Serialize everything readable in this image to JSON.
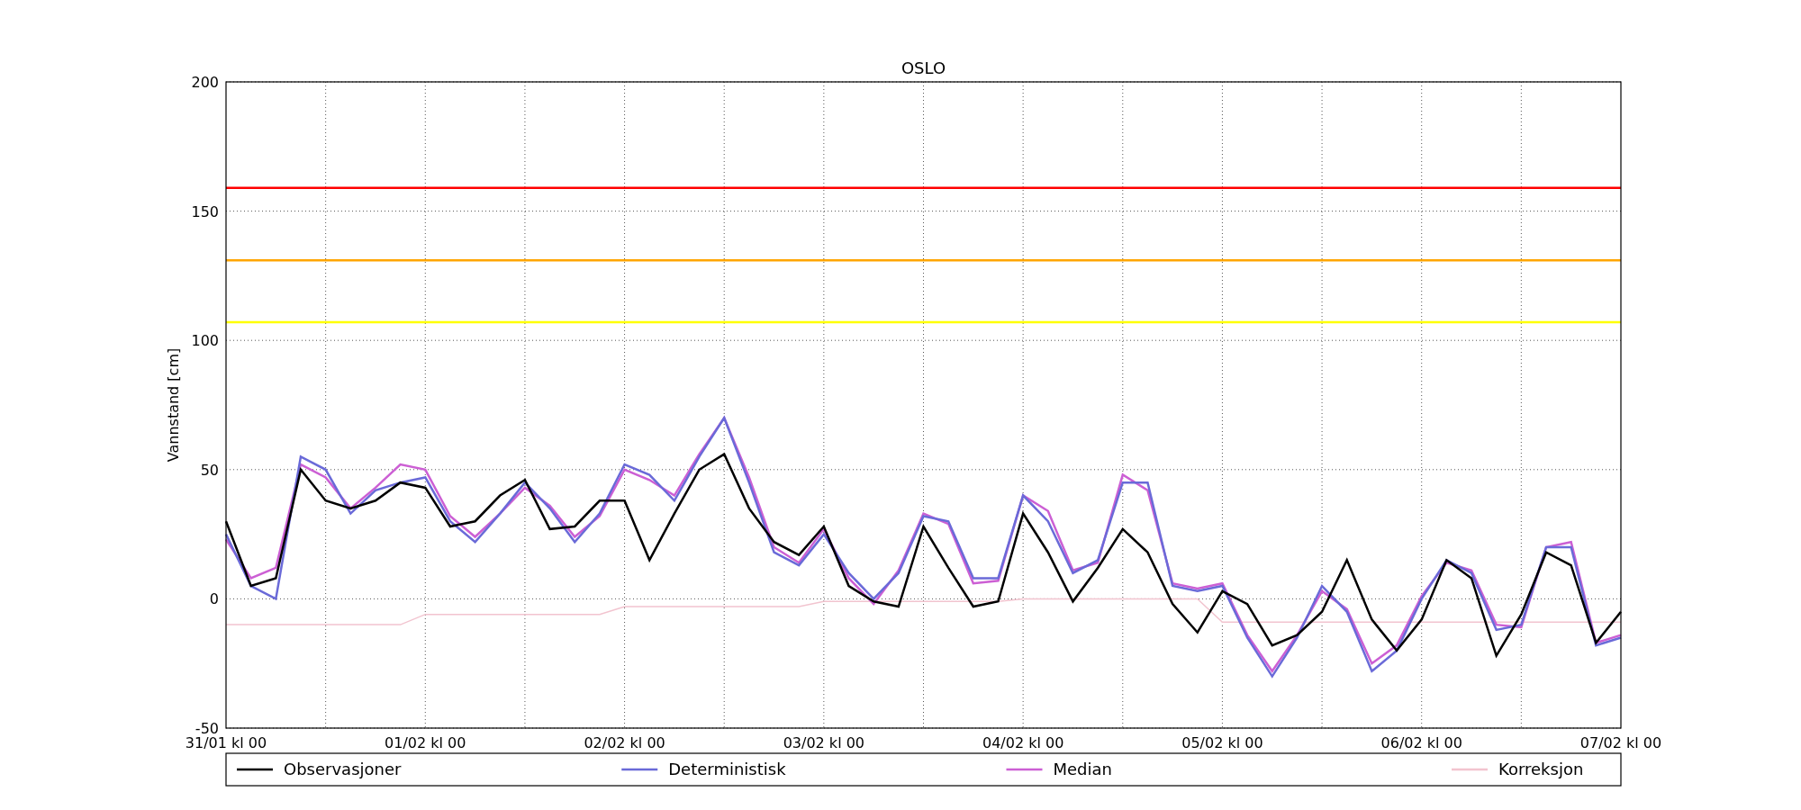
{
  "chart_data": {
    "type": "line",
    "title": "OSLO",
    "ylabel": "Vannstand [cm]",
    "categories": [
      "31/01 kl 00",
      null,
      null,
      null,
      null,
      null,
      null,
      null,
      "01/02 kl 00",
      null,
      null,
      null,
      null,
      null,
      null,
      null,
      "02/02 kl 00",
      null,
      null,
      null,
      null,
      null,
      null,
      null,
      "03/02 kl 00",
      null,
      null,
      null,
      null,
      null,
      null,
      null,
      "04/02 kl 00",
      null,
      null,
      null,
      null,
      null,
      null,
      null,
      "05/02 kl 00",
      null,
      null,
      null,
      null,
      null,
      null,
      null,
      "06/02 kl 00",
      null,
      null,
      null,
      null,
      null,
      null,
      null,
      "07/02 kl 00"
    ],
    "ylim": [
      -50,
      200
    ],
    "yticks": [
      -50,
      0,
      50,
      100,
      150,
      200
    ],
    "series": [
      {
        "name": "Observasjoner",
        "color": "#000000",
        "values": [
          30,
          5,
          8,
          50,
          38,
          35,
          38,
          45,
          43,
          28,
          30,
          40,
          46,
          27,
          28,
          38,
          38,
          15,
          33,
          50,
          56,
          35,
          22,
          17,
          28,
          5,
          -1,
          -3,
          28,
          12,
          -3,
          -1,
          33,
          18,
          -1,
          12,
          27,
          18,
          -2,
          -13,
          3,
          -2,
          -18,
          -14,
          -5,
          15,
          -8,
          -20,
          -8,
          15,
          8,
          -22,
          -6,
          18,
          13,
          -17,
          -5
        ]
      },
      {
        "name": "Deterministisk",
        "color": "#6a6ad8",
        "values": [
          25,
          5,
          0,
          55,
          50,
          33,
          42,
          45,
          47,
          30,
          22,
          33,
          45,
          35,
          22,
          33,
          52,
          48,
          38,
          55,
          70,
          45,
          18,
          13,
          25,
          10,
          0,
          10,
          32,
          30,
          8,
          8,
          40,
          30,
          10,
          15,
          45,
          45,
          5,
          3,
          5,
          -15,
          -30,
          -15,
          5,
          -5,
          -28,
          -20,
          0,
          15,
          10,
          -12,
          -10,
          20,
          20,
          -18,
          -15
        ]
      },
      {
        "name": "Median",
        "color": "#cc5fd4",
        "values": [
          23,
          8,
          12,
          52,
          47,
          35,
          43,
          52,
          50,
          32,
          24,
          33,
          43,
          36,
          24,
          32,
          50,
          46,
          40,
          56,
          70,
          47,
          20,
          14,
          27,
          8,
          -2,
          11,
          33,
          29,
          6,
          7,
          40,
          34,
          11,
          14,
          48,
          42,
          6,
          4,
          6,
          -14,
          -28,
          -14,
          3,
          -4,
          -25,
          -18,
          1,
          14,
          11,
          -10,
          -11,
          20,
          22,
          -17,
          -14
        ]
      },
      {
        "name": "Korreksjon",
        "color": "#f2c4cf",
        "values": [
          -10,
          -10,
          -10,
          -10,
          -10,
          -10,
          -10,
          -10,
          -6,
          -6,
          -6,
          -6,
          -6,
          -6,
          -6,
          -6,
          -3,
          -3,
          -3,
          -3,
          -3,
          -3,
          -3,
          -3,
          -1,
          -1,
          -1,
          -1,
          -1,
          -1,
          -1,
          -1,
          0,
          0,
          0,
          0,
          0,
          0,
          0,
          0,
          -9,
          -9,
          -9,
          -9,
          -9,
          -9,
          -9,
          -9,
          -9,
          -9,
          -9,
          -9,
          -9,
          -9,
          -9,
          -9,
          -9
        ]
      }
    ],
    "grid": true,
    "legend": true,
    "ref_lines": [
      {
        "axis": "y",
        "value": 159,
        "color": "#ff0000"
      },
      {
        "axis": "y",
        "value": 131,
        "color": "#ffa500"
      },
      {
        "axis": "y",
        "value": 107,
        "color": "#ffff00"
      }
    ]
  }
}
